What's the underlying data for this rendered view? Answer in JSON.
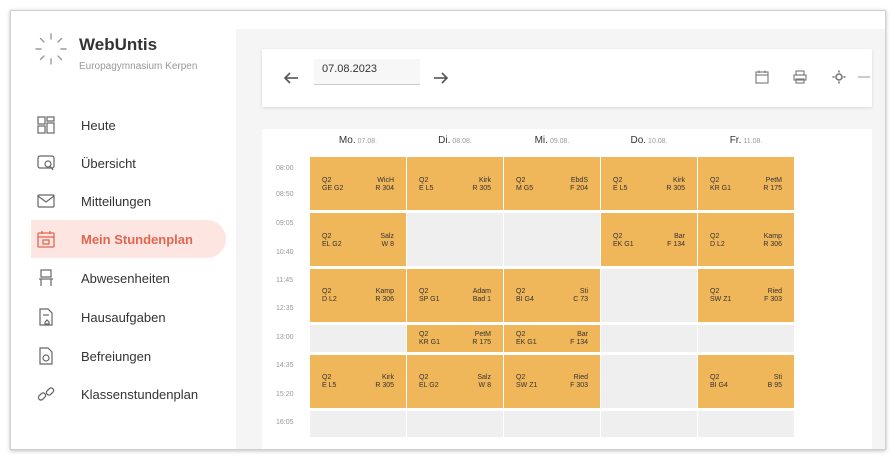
{
  "brand": {
    "name": "WebUntis",
    "school": "Europagymnasium Kerpen"
  },
  "nav": [
    {
      "label": "Heute",
      "icon": "dashboard-icon"
    },
    {
      "label": "Übersicht",
      "icon": "overview-icon"
    },
    {
      "label": "Mitteilungen",
      "icon": "mail-icon"
    },
    {
      "label": "Mein Stundenplan",
      "icon": "calendar-icon",
      "active": true
    },
    {
      "label": "Abwesenheiten",
      "icon": "chair-icon"
    },
    {
      "label": "Hausaufgaben",
      "icon": "homework-icon"
    },
    {
      "label": "Befreiungen",
      "icon": "exemption-icon"
    },
    {
      "label": "Klassenstundenplan",
      "icon": "link-icon"
    }
  ],
  "toolbar": {
    "date": "07.08.2023"
  },
  "timetable": {
    "days": [
      {
        "name": "Mo.",
        "date": "07.08."
      },
      {
        "name": "Di.",
        "date": "08.08."
      },
      {
        "name": "Mi.",
        "date": "09.08."
      },
      {
        "name": "Do.",
        "date": "10.08."
      },
      {
        "name": "Fr.",
        "date": "11.08."
      }
    ],
    "times": [
      "08:00",
      "08:50",
      "09:05",
      "10:40",
      "11:45",
      "12:35",
      "13:00",
      "14:35",
      "15:20",
      "16:05"
    ],
    "lessons": {
      "mo1": {
        "a1": "Q2",
        "a2": "GE G2",
        "b1": "WicH",
        "b2": "R 304"
      },
      "di1": {
        "a1": "Q2",
        "a2": "E L5",
        "b1": "Kirk",
        "b2": "R 305"
      },
      "mi1": {
        "a1": "Q2",
        "a2": "M G5",
        "b1": "EbdS",
        "b2": "F 204"
      },
      "do1": {
        "a1": "Q2",
        "a2": "E L5",
        "b1": "Kirk",
        "b2": "R 305"
      },
      "fr1": {
        "a1": "Q2",
        "a2": "KR G1",
        "b1": "PetM",
        "b2": "R 175"
      },
      "mo2": {
        "a1": "Q2",
        "a2": "EL G2",
        "b1": "Salz",
        "b2": "W 8"
      },
      "do2": {
        "a1": "Q2",
        "a2": "EK G1",
        "b1": "Bar",
        "b2": "F 134"
      },
      "fr2": {
        "a1": "Q2",
        "a2": "D L2",
        "b1": "Kamp",
        "b2": "R 306"
      },
      "mo3": {
        "a1": "Q2",
        "a2": "D L2",
        "b1": "Kamp",
        "b2": "R 306"
      },
      "di3": {
        "a1": "Q2",
        "a2": "SP G1",
        "b1": "Adam",
        "b2": "Bad 1"
      },
      "mi3": {
        "a1": "Q2",
        "a2": "BI G4",
        "b1": "Sti",
        "b2": "C 73"
      },
      "fr3": {
        "a1": "Q2",
        "a2": "SW Z1",
        "b1": "Ried",
        "b2": "F 303"
      },
      "di4": {
        "a1": "Q2",
        "a2": "KR G1",
        "b1": "PetM",
        "b2": "R 175"
      },
      "mi4": {
        "a1": "Q2",
        "a2": "EK G1",
        "b1": "Bar",
        "b2": "F 134"
      },
      "mo5": {
        "a1": "Q2",
        "a2": "E L5",
        "b1": "Kirk",
        "b2": "R 305"
      },
      "di5": {
        "a1": "Q2",
        "a2": "EL G2",
        "b1": "Salz",
        "b2": "W 8"
      },
      "mi5": {
        "a1": "Q2",
        "a2": "SW Z1",
        "b1": "Ried",
        "b2": "F 303"
      },
      "fr5": {
        "a1": "Q2",
        "a2": "BI G4",
        "b1": "Sti",
        "b2": "B 95"
      }
    }
  },
  "colors": {
    "accent": "#e2664f",
    "lesson": "#f0b65a",
    "active_bg": "#fde6e1"
  }
}
